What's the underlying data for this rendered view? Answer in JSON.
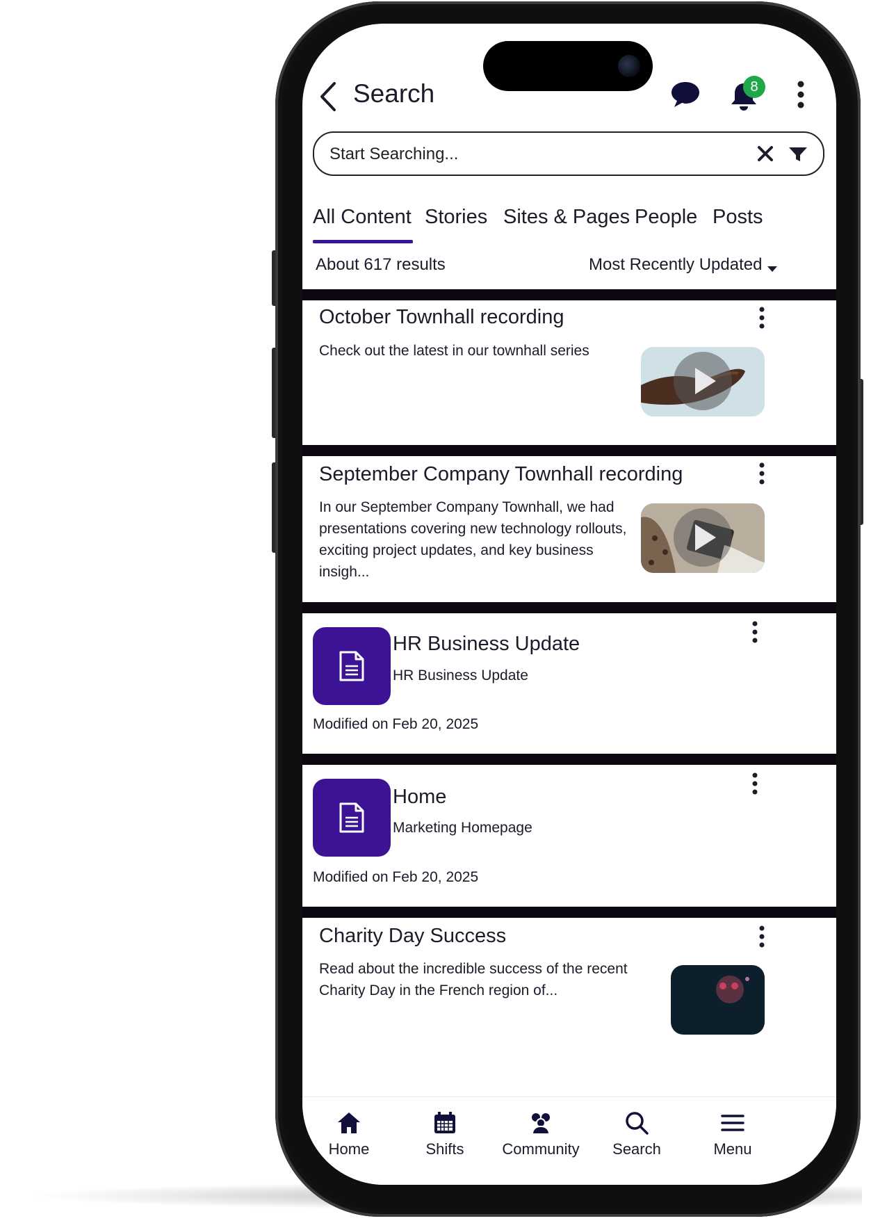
{
  "header": {
    "title": "Search",
    "notification_count": "8"
  },
  "search": {
    "placeholder": "Start Searching..."
  },
  "tabs": [
    {
      "label": "All Content",
      "active": true
    },
    {
      "label": "Stories"
    },
    {
      "label": "Sites & Pages"
    },
    {
      "label": "People"
    },
    {
      "label": "Posts"
    }
  ],
  "summary": {
    "results": "About 617 results",
    "sort": "Most Recently Updated"
  },
  "results": [
    {
      "title": "October Townhall recording",
      "description": "Check out the latest in our townhall series"
    },
    {
      "title": "September Company Townhall recording",
      "description": "In our September Company Townhall, we had presentations covering new technology rollouts, exciting project updates, and key business insigh..."
    },
    {
      "title": "HR Business Update",
      "subtitle": "HR Business Update",
      "modified": "Modified on Feb 20, 2025"
    },
    {
      "title": "Home",
      "subtitle": "Marketing Homepage",
      "modified": "Modified on Feb 20, 2025"
    },
    {
      "title": "Charity Day Success",
      "description": "Read about the incredible success of the recent Charity Day in the French region of..."
    }
  ],
  "bottom_nav": [
    {
      "label": "Home",
      "icon": "home-icon"
    },
    {
      "label": "Shifts",
      "icon": "calendar-icon"
    },
    {
      "label": "Community",
      "icon": "community-icon"
    },
    {
      "label": "Search",
      "icon": "search-icon"
    },
    {
      "label": "Menu",
      "icon": "menu-icon"
    }
  ],
  "colors": {
    "accent": "#3d1395",
    "badge": "#1fa84a",
    "separator": "#0d0711"
  }
}
